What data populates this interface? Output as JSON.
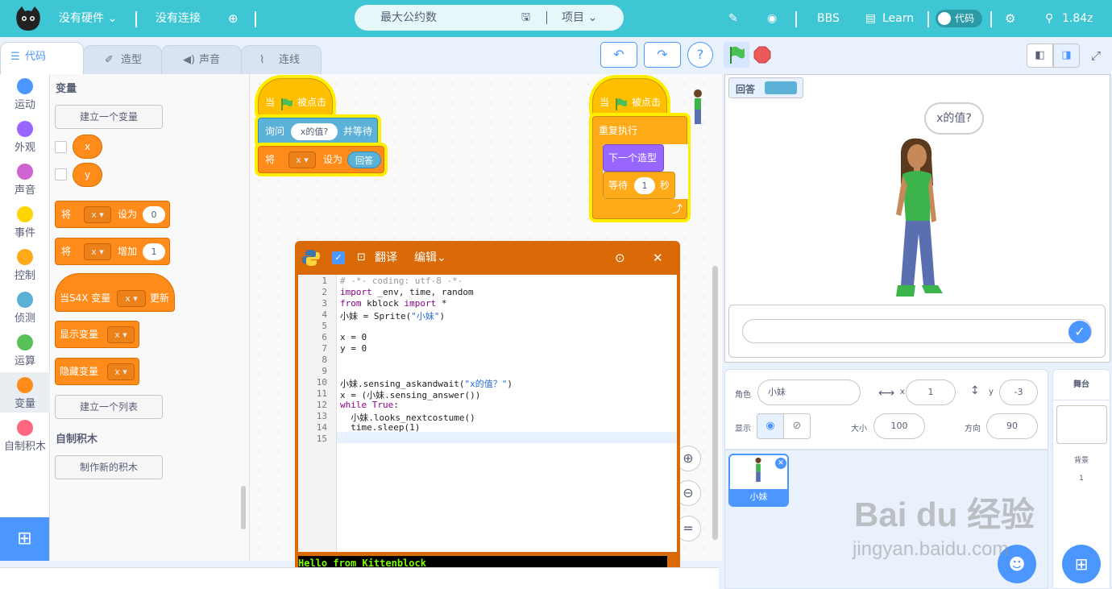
{
  "topbar": {
    "hardware": "没有硬件",
    "connection": "没有连接",
    "project_name": "最大公约数",
    "project_menu": "项目",
    "bbs": "BBS",
    "learn": "Learn",
    "code_toggle": "代码",
    "version": "1.84z"
  },
  "tabs": [
    "代码",
    "造型",
    "声音",
    "连线"
  ],
  "categories": [
    "运动",
    "外观",
    "声音",
    "事件",
    "控制",
    "侦测",
    "运算",
    "变量",
    "自制积木"
  ],
  "category_colors": [
    "#4c97ff",
    "#9966ff",
    "#cf63cf",
    "#ffd500",
    "#ffab19",
    "#5cb1d6",
    "#59c059",
    "#ff8c1a",
    "#ff6680"
  ],
  "palette": {
    "section_variables": "变量",
    "make_variable": "建立一个变量",
    "var_x": "x",
    "var_y": "y",
    "set_label": "将",
    "set_to": "设为",
    "set_value": "0",
    "change_by": "增加",
    "change_value": "1",
    "when_var": "当S4X 变量",
    "when_var_update": "更新",
    "show_var": "显示变量",
    "hide_var": "隐藏变量",
    "make_list": "建立一个列表",
    "section_custom": "自制积木",
    "make_block": "制作新的积木"
  },
  "script1": {
    "when": "当",
    "clicked": "被点击",
    "ask": "询问",
    "ask_text": "x的值?",
    "and_wait": "并等待",
    "set": "将",
    "var": "x",
    "set_to": "设为",
    "answer": "回答"
  },
  "script2": {
    "when": "当",
    "clicked": "被点击",
    "forever": "重复执行",
    "next_costume": "下一个造型",
    "wait": "等待",
    "wait_value": "1",
    "seconds": "秒"
  },
  "python": {
    "translate": "翻译",
    "edit": "编辑",
    "lines": [
      "# -*- coding: utf-8 -*-",
      "import _env, time, random",
      "from kblock import *",
      "小妹 = Sprite(\"小妹\")",
      "",
      "x = 0",
      "y = 0",
      "",
      "",
      "小妹.sensing_askandwait(\"x的值？\")",
      "x = (小妹.sensing_answer())",
      "while True:",
      "  小妹.looks_nextcostume()",
      "  time.sleep(1)",
      ""
    ],
    "terminal_line1": "Hello from Kittenblock",
    "terminal_prompt": "$"
  },
  "stage": {
    "monitor_label": "回答",
    "speech": "x的值?"
  },
  "sprite_info": {
    "sprite_label": "角色",
    "sprite_name": "小妹",
    "x_label": "x",
    "x_value": "1",
    "y_label": "y",
    "y_value": "-3",
    "show_label": "显示",
    "size_label": "大小",
    "size_value": "100",
    "direction_label": "方向",
    "direction_value": "90",
    "thumb_name": "小妹"
  },
  "stage_panel": {
    "title": "舞台",
    "backdrop_label": "背景",
    "backdrop_count": "1"
  },
  "watermark": {
    "brand": "Bai du 经验",
    "url": "jingyan.baidu.com"
  }
}
